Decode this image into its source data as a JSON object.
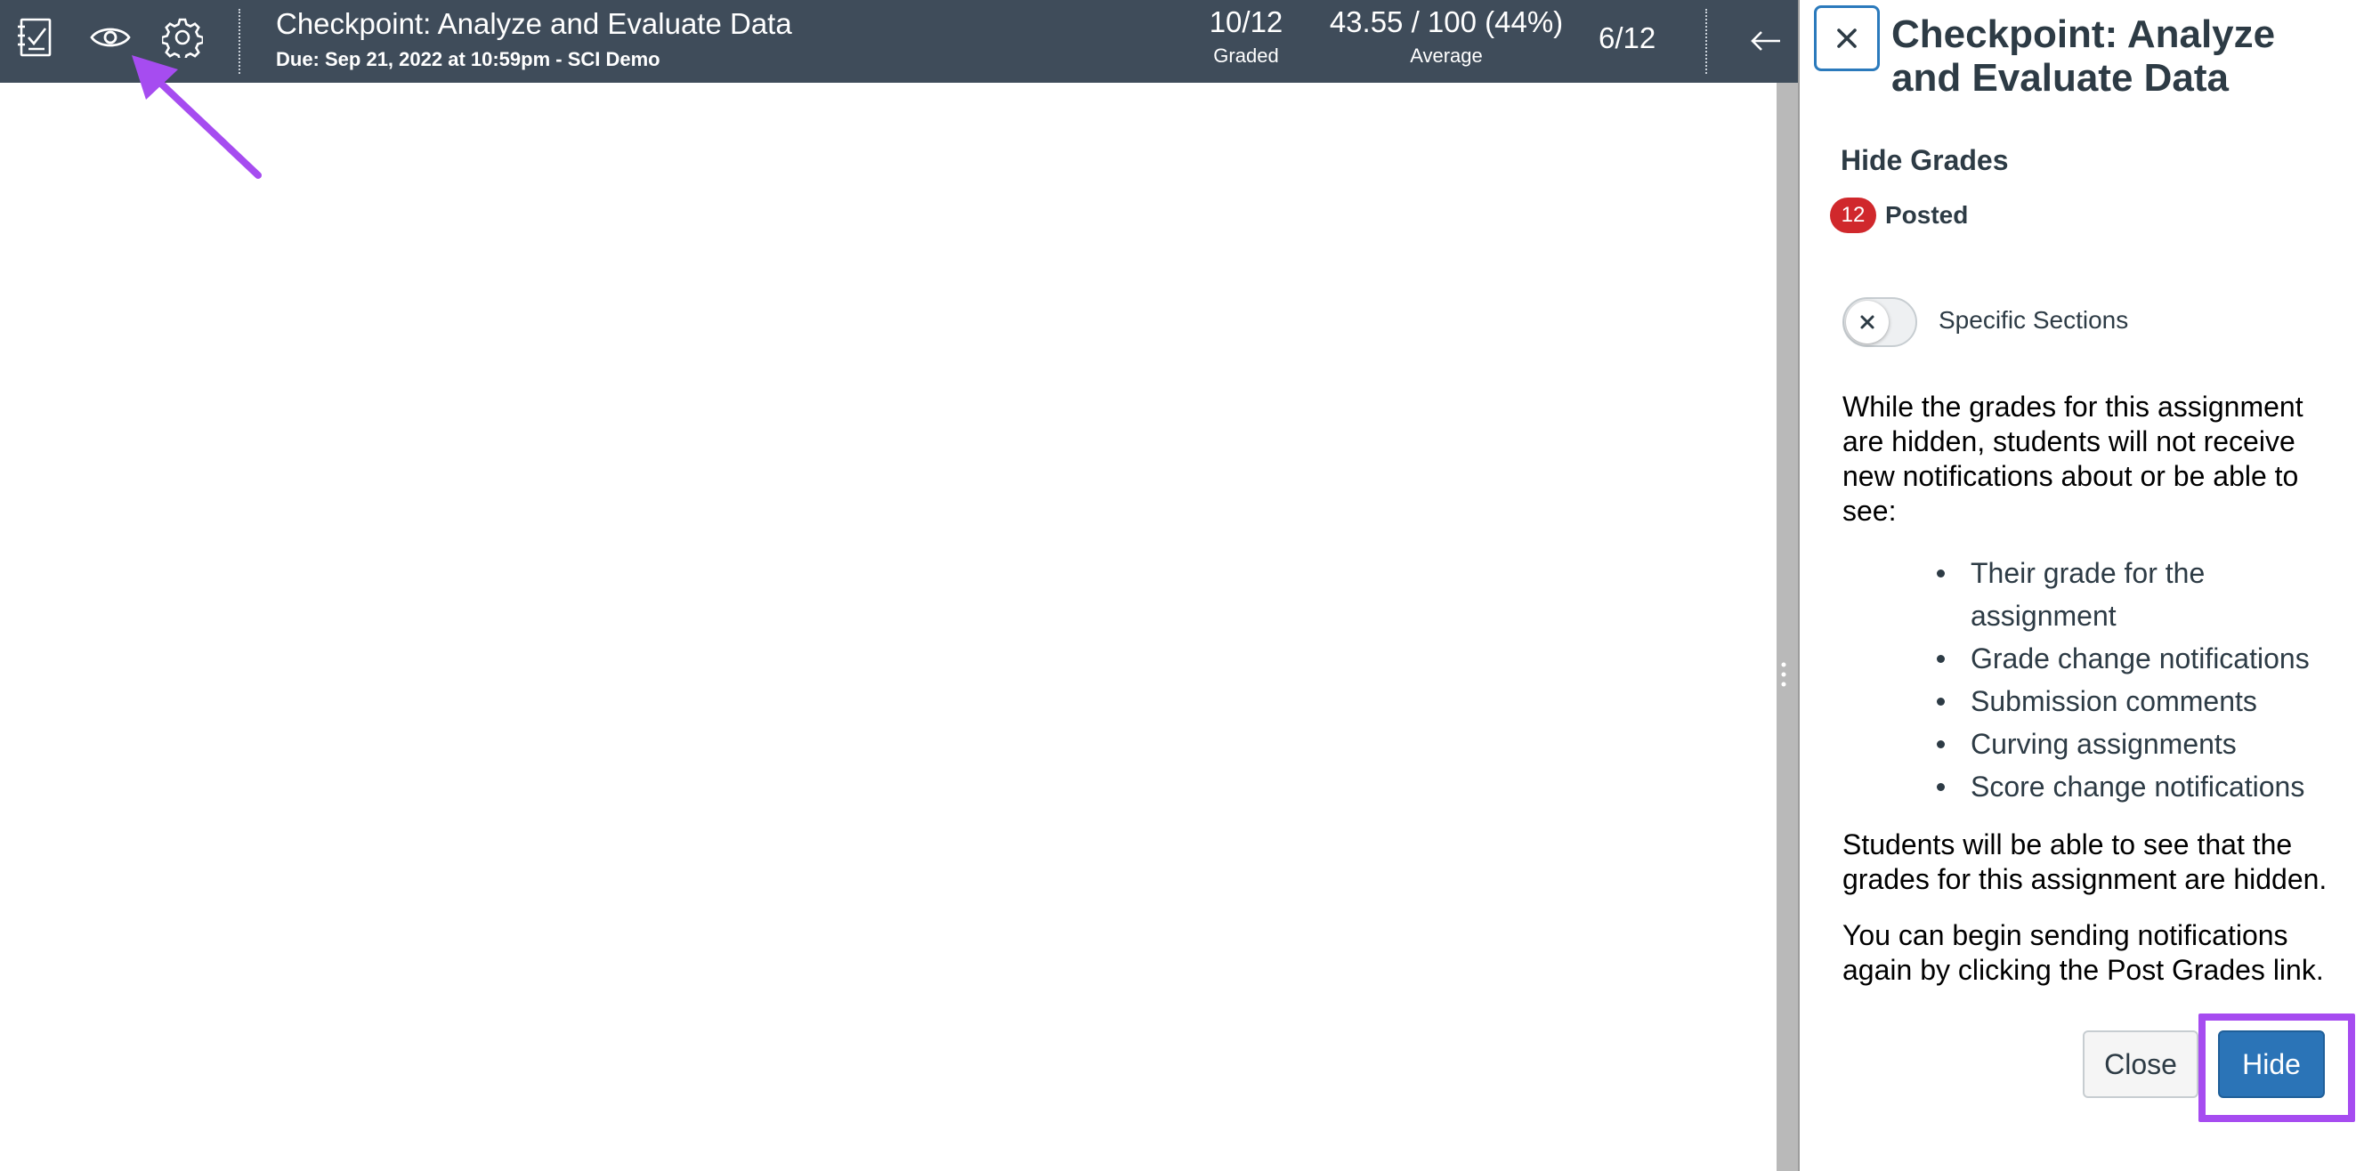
{
  "header": {
    "title": "Checkpoint: Analyze and Evaluate Data",
    "subtitle": "Due: Sep 21, 2022 at 10:59pm - SCI Demo",
    "graded": {
      "value": "10/12",
      "label": "Graded"
    },
    "average": {
      "value": "43.55 / 100 (44%)",
      "label": "Average"
    },
    "student_position": "6/12",
    "icons": {
      "gradebook": "gradebook-icon",
      "visibility": "eye-icon",
      "settings": "gear-icon",
      "previous": "arrow-left-icon"
    }
  },
  "tray": {
    "close_icon": "close-icon",
    "title": "Checkpoint: Analyze and Evaluate Data",
    "heading": "Hide Grades",
    "posted_count": "12",
    "posted_label": "Posted",
    "specific_sections": {
      "label": "Specific Sections",
      "enabled": false
    },
    "intro": "While the grades for this assignment are hidden, students will not receive new notifications about or be able to see:",
    "bullets": [
      "Their grade for the assignment",
      "Grade change notifications",
      "Submission comments",
      "Curving assignments",
      "Score change notifications"
    ],
    "note_hidden": "Students will be able to see that the grades for this assignment are hidden.",
    "note_post": "You can begin sending notifications again by clicking the Post Grades link.",
    "buttons": {
      "close": "Close",
      "hide": "Hide"
    }
  },
  "colors": {
    "topbar_bg": "#3f4c5a",
    "primary_button": "#2b74b7",
    "badge": "#d0282c",
    "annotation": "#a64cf0"
  }
}
